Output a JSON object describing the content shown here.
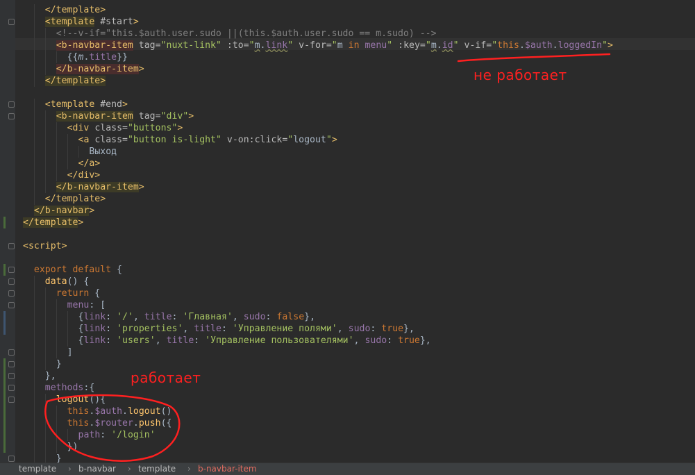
{
  "editor": {
    "lines": [
      {
        "indent": 4,
        "tokens": [
          {
            "c": "t-tag",
            "t": "</template>"
          }
        ]
      },
      {
        "indent": 4,
        "tokens": [
          {
            "c": "t-tagbg",
            "t": "<template"
          },
          {
            "c": "t-plain",
            "t": " "
          },
          {
            "c": "t-attr",
            "t": "#start"
          },
          {
            "c": "t-tag",
            "t": ">"
          }
        ]
      },
      {
        "indent": 6,
        "tokens": [
          {
            "c": "t-cmt",
            "t": "<!--v-if=\"this.$auth.user.sudo ||(this.$auth.user.sudo == m.sudo) -->"
          }
        ]
      },
      {
        "indent": 6,
        "tokens": [
          {
            "c": "t-tagerr",
            "t": "<b-navbar-item"
          },
          {
            "c": "t-plain",
            "t": " "
          },
          {
            "c": "t-attr",
            "t": "tag="
          },
          {
            "c": "t-str",
            "t": "\"nuxt-link\""
          },
          {
            "c": "t-plain",
            "t": " "
          },
          {
            "c": "t-attr",
            "t": ":to="
          },
          {
            "c": "t-str",
            "t": "\""
          },
          {
            "c": "t-plain t-under",
            "t": "m"
          },
          {
            "c": "t-plain",
            "t": "."
          },
          {
            "c": "t-vue t-under",
            "t": "link"
          },
          {
            "c": "t-str",
            "t": "\""
          },
          {
            "c": "t-plain",
            "t": " "
          },
          {
            "c": "t-attr",
            "t": "v-for="
          },
          {
            "c": "t-str",
            "t": "\""
          },
          {
            "c": "t-plain",
            "t": "m "
          },
          {
            "c": "t-kw",
            "t": "in"
          },
          {
            "c": "t-plain",
            "t": " "
          },
          {
            "c": "t-vue",
            "t": "menu"
          },
          {
            "c": "t-str",
            "t": "\""
          },
          {
            "c": "t-plain",
            "t": " "
          },
          {
            "c": "t-attr",
            "t": ":key="
          },
          {
            "c": "t-str",
            "t": "\""
          },
          {
            "c": "t-plain t-under",
            "t": "m"
          },
          {
            "c": "t-plain",
            "t": "."
          },
          {
            "c": "t-vue t-under",
            "t": "id"
          },
          {
            "c": "t-str",
            "t": "\""
          },
          {
            "c": "t-plain",
            "t": " "
          },
          {
            "c": "t-attr",
            "t": "v-if="
          },
          {
            "c": "t-str",
            "t": "\""
          },
          {
            "c": "t-kw",
            "t": "this"
          },
          {
            "c": "t-plain",
            "t": "."
          },
          {
            "c": "t-vue",
            "t": "$auth"
          },
          {
            "c": "t-plain",
            "t": "."
          },
          {
            "c": "t-vue",
            "t": "loggedIn"
          },
          {
            "c": "t-str",
            "t": "\""
          },
          {
            "c": "t-tag",
            "t": ">"
          }
        ]
      },
      {
        "indent": 8,
        "tokens": [
          {
            "c": "t-plain",
            "t": "{{"
          },
          {
            "c": "t-plain t-it",
            "t": "m"
          },
          {
            "c": "t-plain",
            "t": "."
          },
          {
            "c": "t-vue",
            "t": "title"
          },
          {
            "c": "t-plain",
            "t": "}}"
          }
        ]
      },
      {
        "indent": 6,
        "tokens": [
          {
            "c": "t-tagerr",
            "t": "</b-navbar-item"
          },
          {
            "c": "t-tag",
            "t": ">"
          }
        ]
      },
      {
        "indent": 4,
        "tokens": [
          {
            "c": "t-tagbg",
            "t": "</template>"
          }
        ]
      },
      {
        "indent": 0,
        "tokens": []
      },
      {
        "indent": 4,
        "tokens": [
          {
            "c": "t-tag",
            "t": "<template"
          },
          {
            "c": "t-plain",
            "t": " "
          },
          {
            "c": "t-attr",
            "t": "#end"
          },
          {
            "c": "t-tag",
            "t": ">"
          }
        ]
      },
      {
        "indent": 6,
        "tokens": [
          {
            "c": "t-tagbg",
            "t": "<b-navbar-item"
          },
          {
            "c": "t-plain",
            "t": " "
          },
          {
            "c": "t-attr",
            "t": "tag="
          },
          {
            "c": "t-str",
            "t": "\"div\""
          },
          {
            "c": "t-tag",
            "t": ">"
          }
        ]
      },
      {
        "indent": 8,
        "tokens": [
          {
            "c": "t-tag",
            "t": "<div"
          },
          {
            "c": "t-plain",
            "t": " "
          },
          {
            "c": "t-attr",
            "t": "class="
          },
          {
            "c": "t-str",
            "t": "\"buttons\""
          },
          {
            "c": "t-tag",
            "t": ">"
          }
        ]
      },
      {
        "indent": 10,
        "tokens": [
          {
            "c": "t-tag",
            "t": "<a"
          },
          {
            "c": "t-plain",
            "t": " "
          },
          {
            "c": "t-attr",
            "t": "class="
          },
          {
            "c": "t-str",
            "t": "\"button is-light\""
          },
          {
            "c": "t-plain",
            "t": " "
          },
          {
            "c": "t-attr",
            "t": "v-on:click="
          },
          {
            "c": "t-str",
            "t": "\""
          },
          {
            "c": "t-plain",
            "t": "logout"
          },
          {
            "c": "t-str",
            "t": "\""
          },
          {
            "c": "t-tag",
            "t": ">"
          }
        ]
      },
      {
        "indent": 12,
        "tokens": [
          {
            "c": "t-plain",
            "t": "Выход"
          }
        ]
      },
      {
        "indent": 10,
        "tokens": [
          {
            "c": "t-tag",
            "t": "</a>"
          }
        ]
      },
      {
        "indent": 8,
        "tokens": [
          {
            "c": "t-tag",
            "t": "</div>"
          }
        ]
      },
      {
        "indent": 6,
        "tokens": [
          {
            "c": "t-tagbg",
            "t": "</b-navbar-item"
          },
          {
            "c": "t-tag",
            "t": ">"
          }
        ]
      },
      {
        "indent": 4,
        "tokens": [
          {
            "c": "t-tag",
            "t": "</template>"
          }
        ]
      },
      {
        "indent": 2,
        "tokens": [
          {
            "c": "t-tagbg",
            "t": "</b-navbar"
          },
          {
            "c": "t-tag",
            "t": ">"
          }
        ]
      },
      {
        "indent": 0,
        "tokens": [
          {
            "c": "t-tagbg",
            "t": "</template"
          },
          {
            "c": "t-tag",
            "t": ">"
          }
        ]
      },
      {
        "indent": 0,
        "tokens": []
      },
      {
        "indent": 0,
        "tokens": [
          {
            "c": "t-tag",
            "t": "<script>"
          }
        ]
      },
      {
        "indent": 0,
        "tokens": []
      },
      {
        "indent": 2,
        "tokens": [
          {
            "c": "t-kw",
            "t": "export default"
          },
          {
            "c": "t-plain",
            "t": " {"
          }
        ]
      },
      {
        "indent": 4,
        "tokens": [
          {
            "c": "t-fn",
            "t": "data"
          },
          {
            "c": "t-plain",
            "t": "() {"
          }
        ]
      },
      {
        "indent": 6,
        "tokens": [
          {
            "c": "t-kw",
            "t": "return"
          },
          {
            "c": "t-plain",
            "t": " {"
          }
        ]
      },
      {
        "indent": 8,
        "tokens": [
          {
            "c": "t-prop",
            "t": "menu"
          },
          {
            "c": "t-plain",
            "t": ": ["
          }
        ]
      },
      {
        "indent": 10,
        "tokens": [
          {
            "c": "t-plain",
            "t": "{"
          },
          {
            "c": "t-prop",
            "t": "link"
          },
          {
            "c": "t-plain",
            "t": ": "
          },
          {
            "c": "t-str",
            "t": "'/'"
          },
          {
            "c": "t-plain",
            "t": ", "
          },
          {
            "c": "t-prop",
            "t": "title"
          },
          {
            "c": "t-plain",
            "t": ": "
          },
          {
            "c": "t-str",
            "t": "'Главная'"
          },
          {
            "c": "t-plain",
            "t": ", "
          },
          {
            "c": "t-prop",
            "t": "sudo"
          },
          {
            "c": "t-plain",
            "t": ": "
          },
          {
            "c": "t-kw",
            "t": "false"
          },
          {
            "c": "t-plain",
            "t": "},"
          }
        ]
      },
      {
        "indent": 10,
        "tokens": [
          {
            "c": "t-plain",
            "t": "{"
          },
          {
            "c": "t-prop",
            "t": "link"
          },
          {
            "c": "t-plain",
            "t": ": "
          },
          {
            "c": "t-str",
            "t": "'properties'"
          },
          {
            "c": "t-plain",
            "t": ", "
          },
          {
            "c": "t-prop",
            "t": "title"
          },
          {
            "c": "t-plain",
            "t": ": "
          },
          {
            "c": "t-str",
            "t": "'Управление полями'"
          },
          {
            "c": "t-plain",
            "t": ", "
          },
          {
            "c": "t-prop",
            "t": "sudo"
          },
          {
            "c": "t-plain",
            "t": ": "
          },
          {
            "c": "t-kw",
            "t": "true"
          },
          {
            "c": "t-plain",
            "t": "},"
          }
        ]
      },
      {
        "indent": 10,
        "tokens": [
          {
            "c": "t-plain",
            "t": "{"
          },
          {
            "c": "t-prop",
            "t": "link"
          },
          {
            "c": "t-plain",
            "t": ": "
          },
          {
            "c": "t-str",
            "t": "'users'"
          },
          {
            "c": "t-plain",
            "t": ", "
          },
          {
            "c": "t-prop",
            "t": "title"
          },
          {
            "c": "t-plain",
            "t": ": "
          },
          {
            "c": "t-str",
            "t": "'Управление пользователями'"
          },
          {
            "c": "t-plain",
            "t": ", "
          },
          {
            "c": "t-prop",
            "t": "sudo"
          },
          {
            "c": "t-plain",
            "t": ": "
          },
          {
            "c": "t-kw",
            "t": "true"
          },
          {
            "c": "t-plain",
            "t": "},"
          }
        ]
      },
      {
        "indent": 8,
        "tokens": [
          {
            "c": "t-plain",
            "t": "]"
          }
        ]
      },
      {
        "indent": 6,
        "tokens": [
          {
            "c": "t-plain",
            "t": "}"
          }
        ]
      },
      {
        "indent": 4,
        "tokens": [
          {
            "c": "t-plain",
            "t": "},"
          }
        ]
      },
      {
        "indent": 4,
        "tokens": [
          {
            "c": "t-prop",
            "t": "methods"
          },
          {
            "c": "t-plain",
            "t": ":{"
          }
        ]
      },
      {
        "indent": 6,
        "tokens": [
          {
            "c": "t-fn",
            "t": "logout"
          },
          {
            "c": "t-plain",
            "t": "(){"
          }
        ]
      },
      {
        "indent": 8,
        "tokens": [
          {
            "c": "t-kw",
            "t": "this"
          },
          {
            "c": "t-plain",
            "t": "."
          },
          {
            "c": "t-vue",
            "t": "$auth"
          },
          {
            "c": "t-plain",
            "t": "."
          },
          {
            "c": "t-fn",
            "t": "logout"
          },
          {
            "c": "t-plain",
            "t": "()"
          }
        ]
      },
      {
        "indent": 8,
        "tokens": [
          {
            "c": "t-kw",
            "t": "this"
          },
          {
            "c": "t-plain",
            "t": "."
          },
          {
            "c": "t-vue",
            "t": "$router"
          },
          {
            "c": "t-plain",
            "t": "."
          },
          {
            "c": "t-fn",
            "t": "push"
          },
          {
            "c": "t-plain",
            "t": "({"
          }
        ]
      },
      {
        "indent": 10,
        "tokens": [
          {
            "c": "t-prop",
            "t": "path"
          },
          {
            "c": "t-plain",
            "t": ": "
          },
          {
            "c": "t-str",
            "t": "'/login'"
          }
        ]
      },
      {
        "indent": 8,
        "tokens": [
          {
            "c": "t-plain",
            "t": "})"
          }
        ]
      },
      {
        "indent": 6,
        "tokens": [
          {
            "c": "t-plain",
            "t": "}"
          }
        ]
      }
    ]
  },
  "annotations": {
    "not_working": "не работает",
    "working": "работает",
    "color": "#ff2020"
  },
  "statusbar": {
    "breadcrumbs": [
      "template",
      "b-navbar",
      "template",
      "b-navbar-item"
    ],
    "separator": "›"
  },
  "colors": {
    "background": "#2b2b2b",
    "gutter": "#313335",
    "tag": "#e8bf6a",
    "string": "#a5c261",
    "keyword": "#cc7832",
    "property": "#9876aa",
    "function": "#ffc66d",
    "comment": "#808080"
  }
}
